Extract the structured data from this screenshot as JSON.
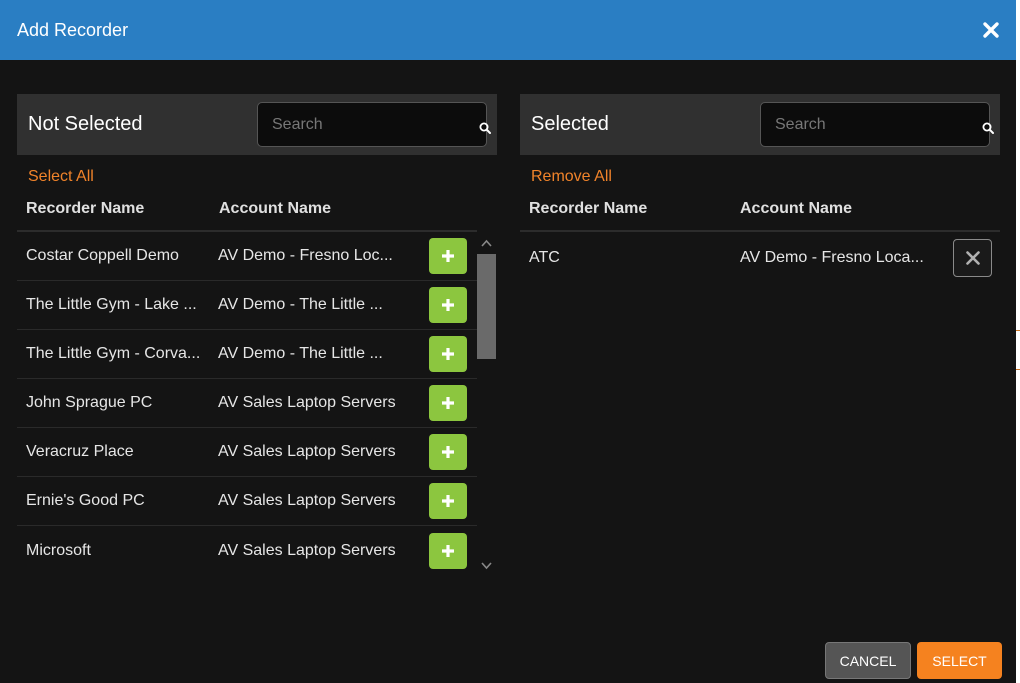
{
  "dialog": {
    "title": "Add Recorder"
  },
  "not_selected": {
    "heading": "Not Selected",
    "search_placeholder": "Search",
    "bulk_label": "Select All",
    "columns": {
      "recorder": "Recorder Name",
      "account": "Account Name"
    },
    "rows": [
      {
        "recorder": "Costar Coppell Demo",
        "account": "AV Demo - Fresno Loc..."
      },
      {
        "recorder": "The Little Gym - Lake ...",
        "account": "AV Demo - The Little ..."
      },
      {
        "recorder": "The Little Gym - Corva...",
        "account": "AV Demo - The Little ..."
      },
      {
        "recorder": "John Sprague PC",
        "account": "AV Sales Laptop Servers"
      },
      {
        "recorder": "Veracruz Place",
        "account": "AV Sales Laptop Servers"
      },
      {
        "recorder": "Ernie's Good PC",
        "account": "AV Sales Laptop Servers"
      },
      {
        "recorder": "Microsoft",
        "account": "AV Sales Laptop Servers"
      }
    ]
  },
  "selected": {
    "heading": "Selected",
    "search_placeholder": "Search",
    "bulk_label": "Remove All",
    "columns": {
      "recorder": "Recorder Name",
      "account": "Account Name"
    },
    "rows": [
      {
        "recorder": "ATC",
        "account": "AV Demo - Fresno Loca..."
      }
    ]
  },
  "footer": {
    "cancel_label": "CANCEL",
    "select_label": "SELECT"
  },
  "colors": {
    "titlebar": "#2a7ec3",
    "accent_link": "#f0832a",
    "add_button": "#8cc63f",
    "primary_button": "#f5821f"
  }
}
